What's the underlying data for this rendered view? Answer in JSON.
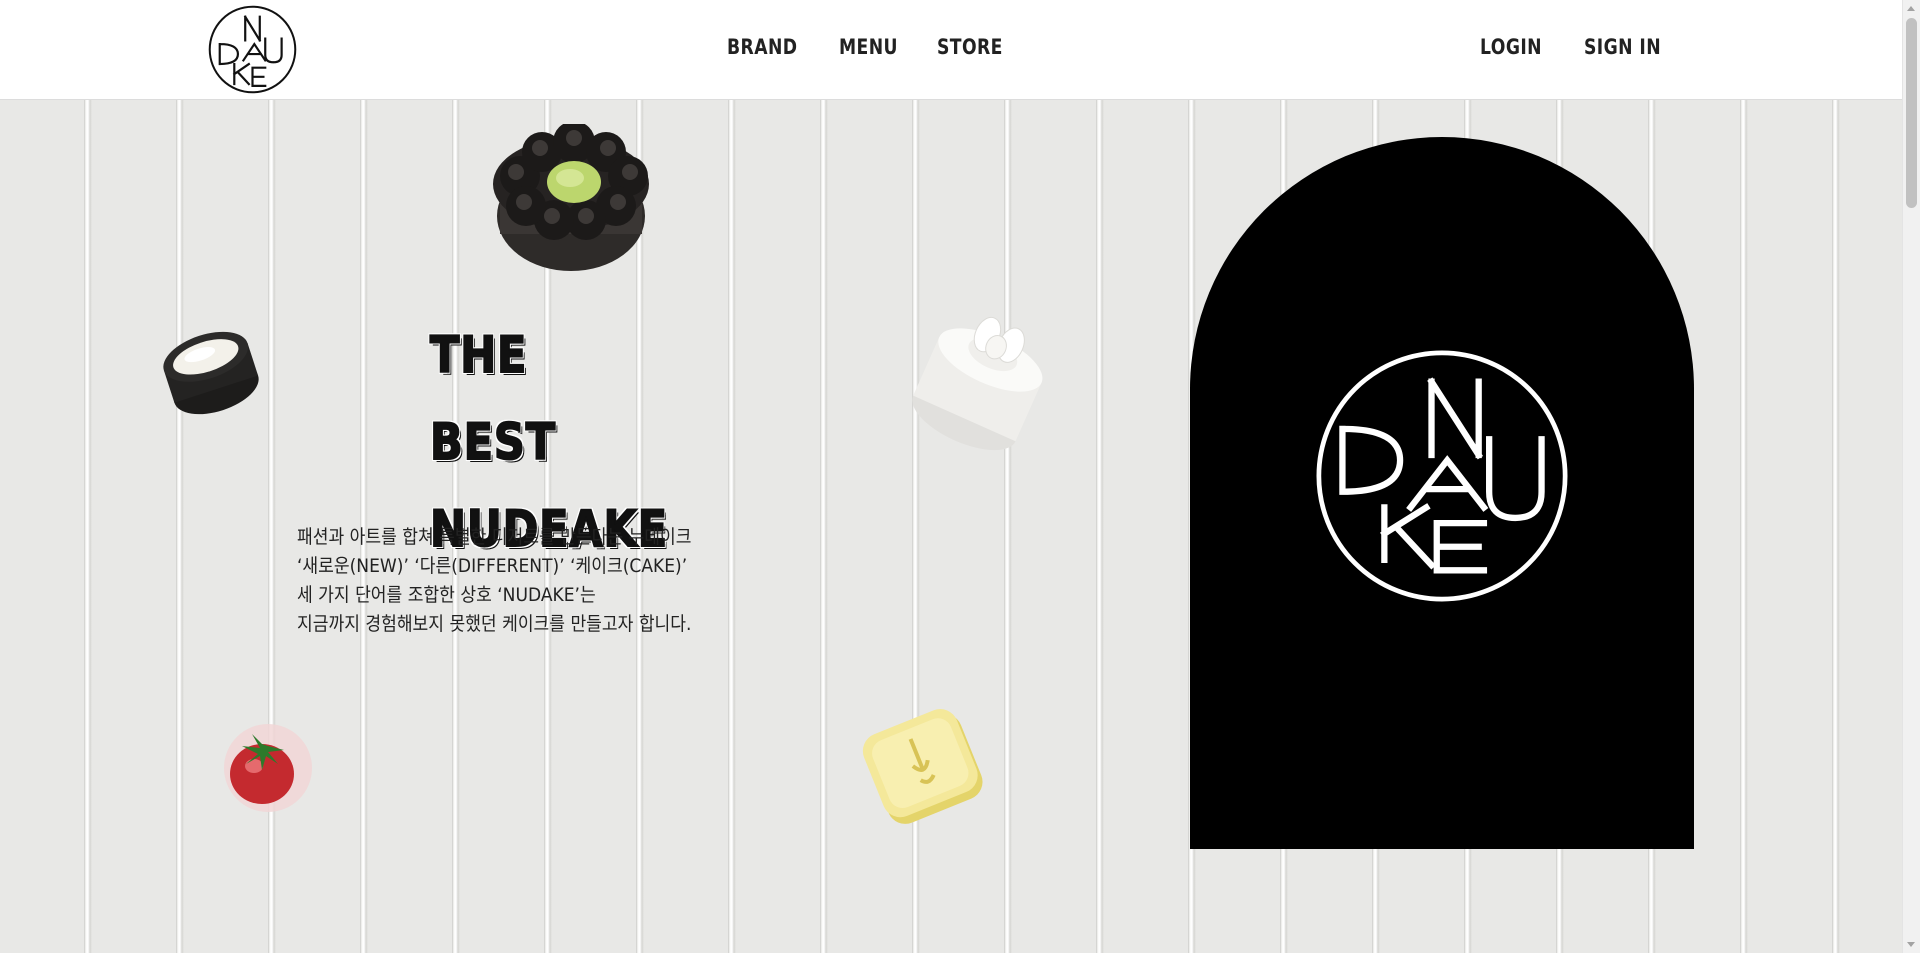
{
  "header": {
    "logo_alt": "NUDAKE",
    "nav_main": [
      "BRAND",
      "MENU",
      "STORE"
    ],
    "nav_user": [
      "LOGIN",
      "SIGN IN"
    ]
  },
  "hero": {
    "headline_line1": "THE BEST",
    "headline_line2": "NUDEAKE",
    "description": [
      "패션과 아트를 합쳐 특별한 디저트를 만든다는 누데이크",
      "‘새로운(NEW)’ ‘다른(DIFFERENT)’ ‘케이크(CAKE)’",
      "세 가지 단어를 조합한 상호 ‘NUDAKE’는",
      "지금까지 경험해보지 못했던 케이크를 만들고자 합니다."
    ]
  },
  "colors": {
    "header_bg": "#ffffff",
    "wall": "#e8e8e6",
    "arch": "#000000",
    "text": "#222222"
  },
  "icons": [
    "nudake-logo-icon",
    "nudake-emblem-icon"
  ]
}
